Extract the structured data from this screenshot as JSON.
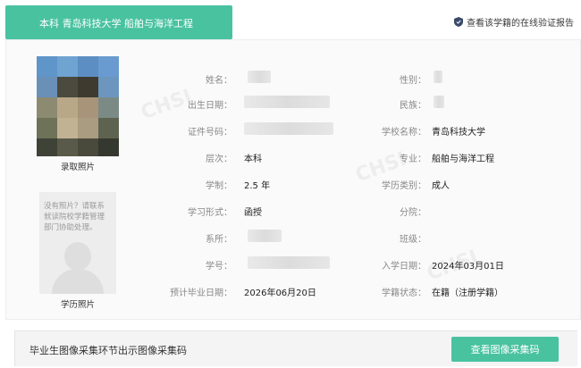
{
  "header": {
    "tab_title": "本科  青岛科技大学 船舶与海洋工程",
    "verify_link": "查看该学籍的在线验证报告"
  },
  "photos": {
    "admission_caption": "录取照片",
    "degree_caption": "学历照片",
    "degree_notice": "没有照片？请联系就读院校学籍管理部门协助处理。"
  },
  "fields": {
    "name_label": "姓名：",
    "gender_label": "性别：",
    "birth_label": "出生日期：",
    "ethnicity_label": "民族：",
    "id_label": "证件号码：",
    "school_label": "学校名称：",
    "school_value": "青岛科技大学",
    "level_label": "层次：",
    "level_value": "本科",
    "major_label": "专业：",
    "major_value": "船舶与海洋工程",
    "duration_label": "学制：",
    "duration_value": "2.5 年",
    "category_label": "学历类别：",
    "category_value": "成人",
    "study_form_label": "学习形式：",
    "study_form_value": "函授",
    "branch_label": "分院：",
    "department_label": "系所：",
    "class_label": "班级：",
    "student_id_label": "学号：",
    "enroll_date_label": "入学日期：",
    "enroll_date_value": "2024年03月01日",
    "grad_date_label": "预计毕业日期：",
    "grad_date_value": "2026年06月20日",
    "status_label": "学籍状态：",
    "status_value": "在籍（注册学籍）"
  },
  "footer": {
    "text": "毕业生图像采集环节出示图像采集码",
    "button": "查看图像采集码"
  },
  "colors": {
    "accent": "#49c2a0"
  }
}
